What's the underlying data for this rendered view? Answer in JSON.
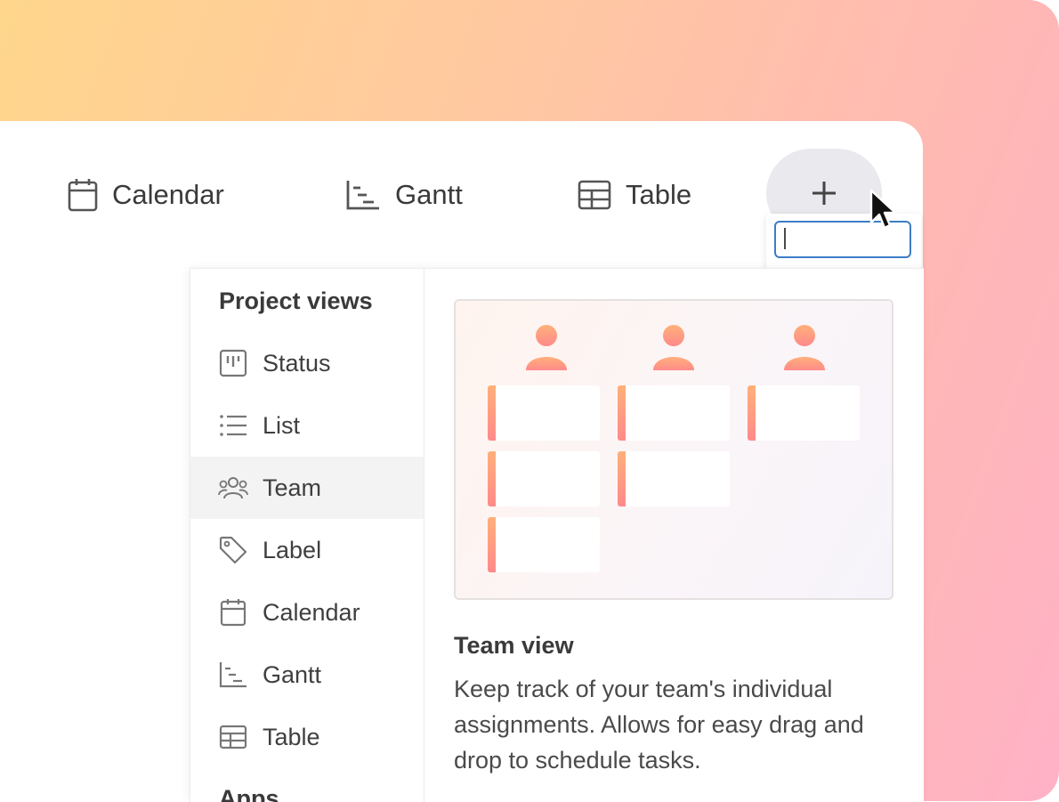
{
  "tabs": [
    {
      "label": "Calendar",
      "icon": "calendar-icon"
    },
    {
      "label": "Gantt",
      "icon": "gantt-icon"
    },
    {
      "label": "Table",
      "icon": "table-icon"
    }
  ],
  "add_button": {
    "icon": "plus-icon"
  },
  "popup_input": {
    "value": "",
    "placeholder": ""
  },
  "menu": {
    "section_title": "Project views",
    "items": [
      {
        "label": "Status",
        "icon": "status-board-icon"
      },
      {
        "label": "List",
        "icon": "list-icon"
      },
      {
        "label": "Team",
        "icon": "team-icon",
        "active": true
      },
      {
        "label": "Label",
        "icon": "tag-icon"
      },
      {
        "label": "Calendar",
        "icon": "calendar-icon"
      },
      {
        "label": "Gantt",
        "icon": "gantt-icon"
      },
      {
        "label": "Table",
        "icon": "table-icon"
      }
    ],
    "section_title_2": "Apps"
  },
  "detail": {
    "title": "Team view",
    "description": "Keep track of your team's individual assignments. Allows for easy drag and drop to schedule tasks."
  },
  "colors": {
    "accent_input_border": "#3c7dc6",
    "active_item_bg": "#f3f3f3",
    "avatar_gradient_start": "#ffb07a",
    "avatar_gradient_end": "#ff8a8a"
  }
}
